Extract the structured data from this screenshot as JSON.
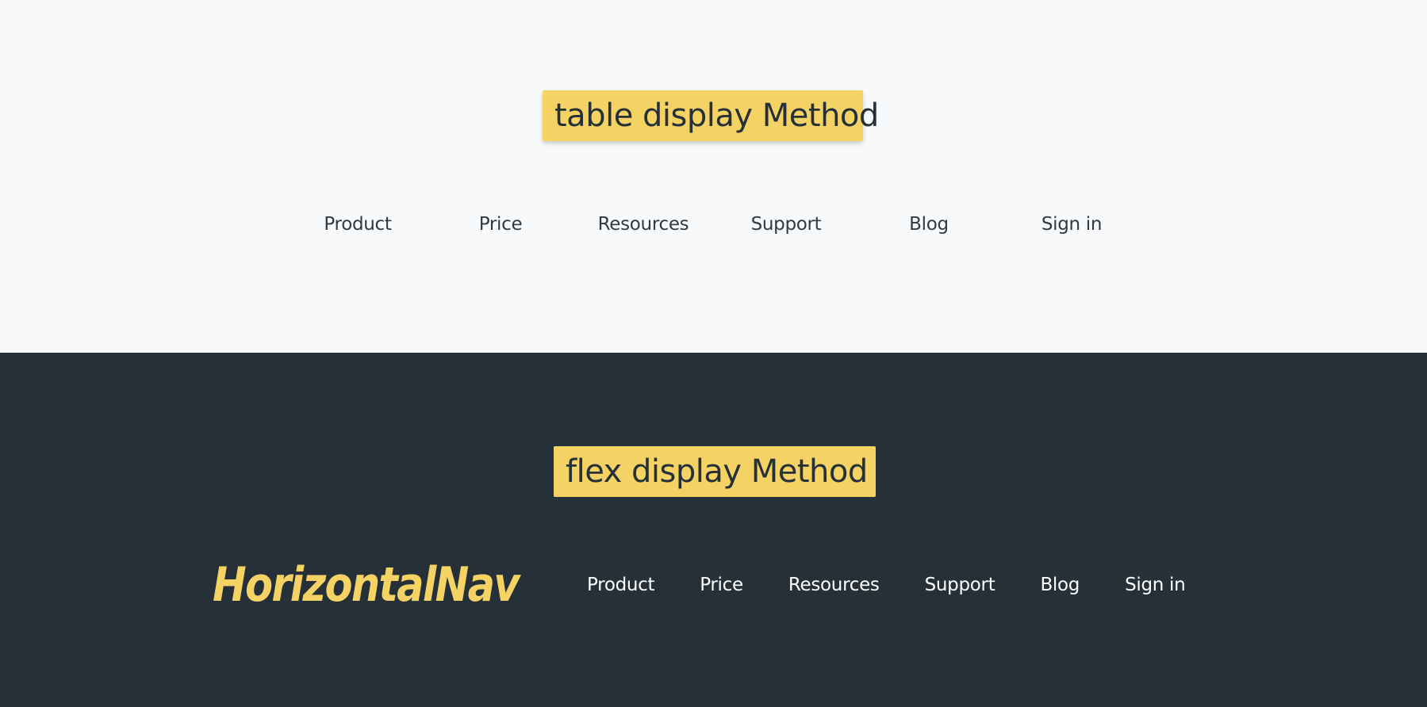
{
  "colors": {
    "light_background": "#f8f9fa",
    "dark_background": "#263038",
    "accent_yellow": "#f5d264",
    "text_dark": "#2f3a42",
    "text_light": "#ffffff"
  },
  "table_section": {
    "title": "table display Method",
    "nav_items": [
      {
        "label": "Product"
      },
      {
        "label": "Price"
      },
      {
        "label": "Resources"
      },
      {
        "label": "Support"
      },
      {
        "label": "Blog"
      },
      {
        "label": "Sign in"
      }
    ]
  },
  "flex_section": {
    "title": "flex display Method",
    "logo": "HorizontalNav",
    "nav_items": [
      {
        "label": "Product"
      },
      {
        "label": "Price"
      },
      {
        "label": "Resources"
      },
      {
        "label": "Support"
      },
      {
        "label": "Blog"
      },
      {
        "label": "Sign in"
      }
    ]
  }
}
